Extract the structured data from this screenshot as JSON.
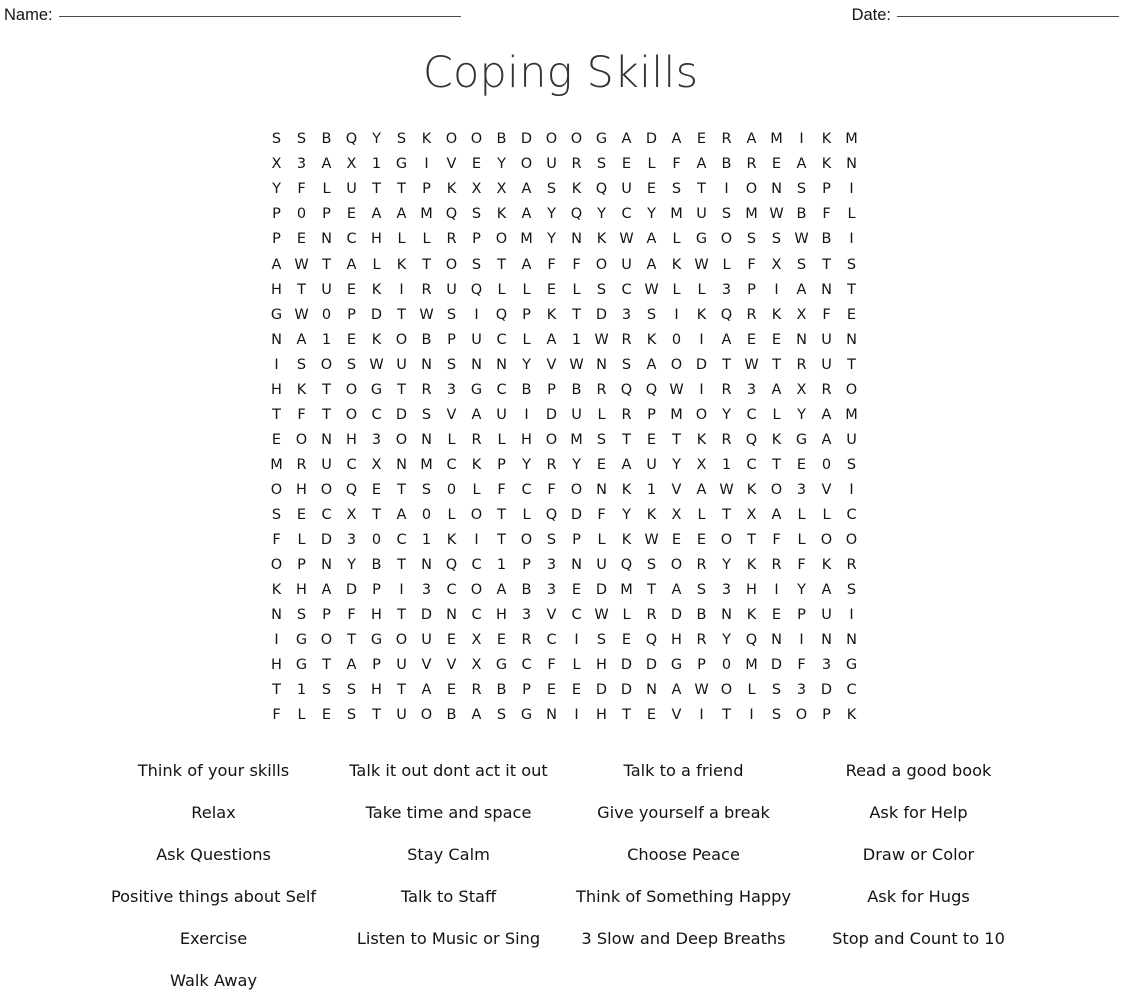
{
  "header": {
    "name_label": "Name:",
    "name_value": "",
    "date_label": "Date:",
    "date_value": ""
  },
  "title": "Coping Skills",
  "puzzle": {
    "rows": 24,
    "cols": 25,
    "grid": [
      "S S B Q Y S K O O B D O O G A D A E R A M I K M",
      "X 3 A X 1 G I V E Y O U R S E L F A B R E A K N",
      "Y F L U T T P K X X A S K Q U E S T I O N S P I",
      "P 0 P E A A M Q S K A Y Q Y C Y M U S M W B F L",
      "P E N C H L L R P O M Y N K W A L G O S S W B I",
      "A W T A L K T O S T A F F O U A K W L F X S T S",
      "H T U E K I R U Q L L E L S C W L L 3 P I A N T",
      "G W 0 P D T W S I Q P K T D 3 S I K Q R K X F E",
      "N A 1 E K O B P U C L A 1 W R K 0 I A E E N U N",
      "I S O S W U N S N N Y V W N S A O D T W T R U T",
      "H K T O G T R 3 G C B P B R Q Q W I R 3 A X R O",
      "T F T O C D S V A U I D U L R P M O Y C L Y A M",
      "E O N H 3 O N L R L H O M S T E T K R Q K G A U",
      "M R U C X N M C K P Y R Y E A U Y X 1 C T E 0 S",
      "O H O Q E T S 0 L F C F O N K 1 V A W K O 3 V I",
      "S E C X T A 0 L O T L Q D F Y K X L T X A L L C",
      "F L D 3 0 C 1 K I T O S P L K W E E O T F L O O",
      "O P N Y B T N Q C 1 P 3 N U Q S O R Y K R F K R",
      "K H A D P I 3 C O A B 3 E D M T A S 3 H I Y A S",
      "N S P F H T D N C H 3 V C W L R D B N K E P U I",
      "I G O T G O U E X E R C I S E Q H R Y Q N I N N",
      "H G T A P U V V X G C F L H D D G P 0 M D F 3 G",
      "T 1 S S H T A E R B P E E D D N A W O L S 3 D C",
      "F L E S T U O B A S G N I H T E V I T I S O P K"
    ]
  },
  "word_list": {
    "columns": 4,
    "words": [
      "Think of your skills",
      "Talk it out dont act it out",
      "Talk to a friend",
      "Read a good book",
      "Relax",
      "Take time and space",
      "Give yourself a break",
      "Ask for Help",
      "Ask Questions",
      "Stay Calm",
      "Choose Peace",
      "Draw or Color",
      "Positive things about Self",
      "Talk to Staff",
      "Think of Something Happy",
      "Ask for Hugs",
      "Exercise",
      "Listen to Music or Sing",
      "3 Slow and Deep Breaths",
      "Stop and Count to 10",
      "Walk Away"
    ]
  },
  "colors": {
    "page_background": "#ffffff",
    "text": "#141414",
    "title": "#333333",
    "rule": "#4a4a4a"
  }
}
